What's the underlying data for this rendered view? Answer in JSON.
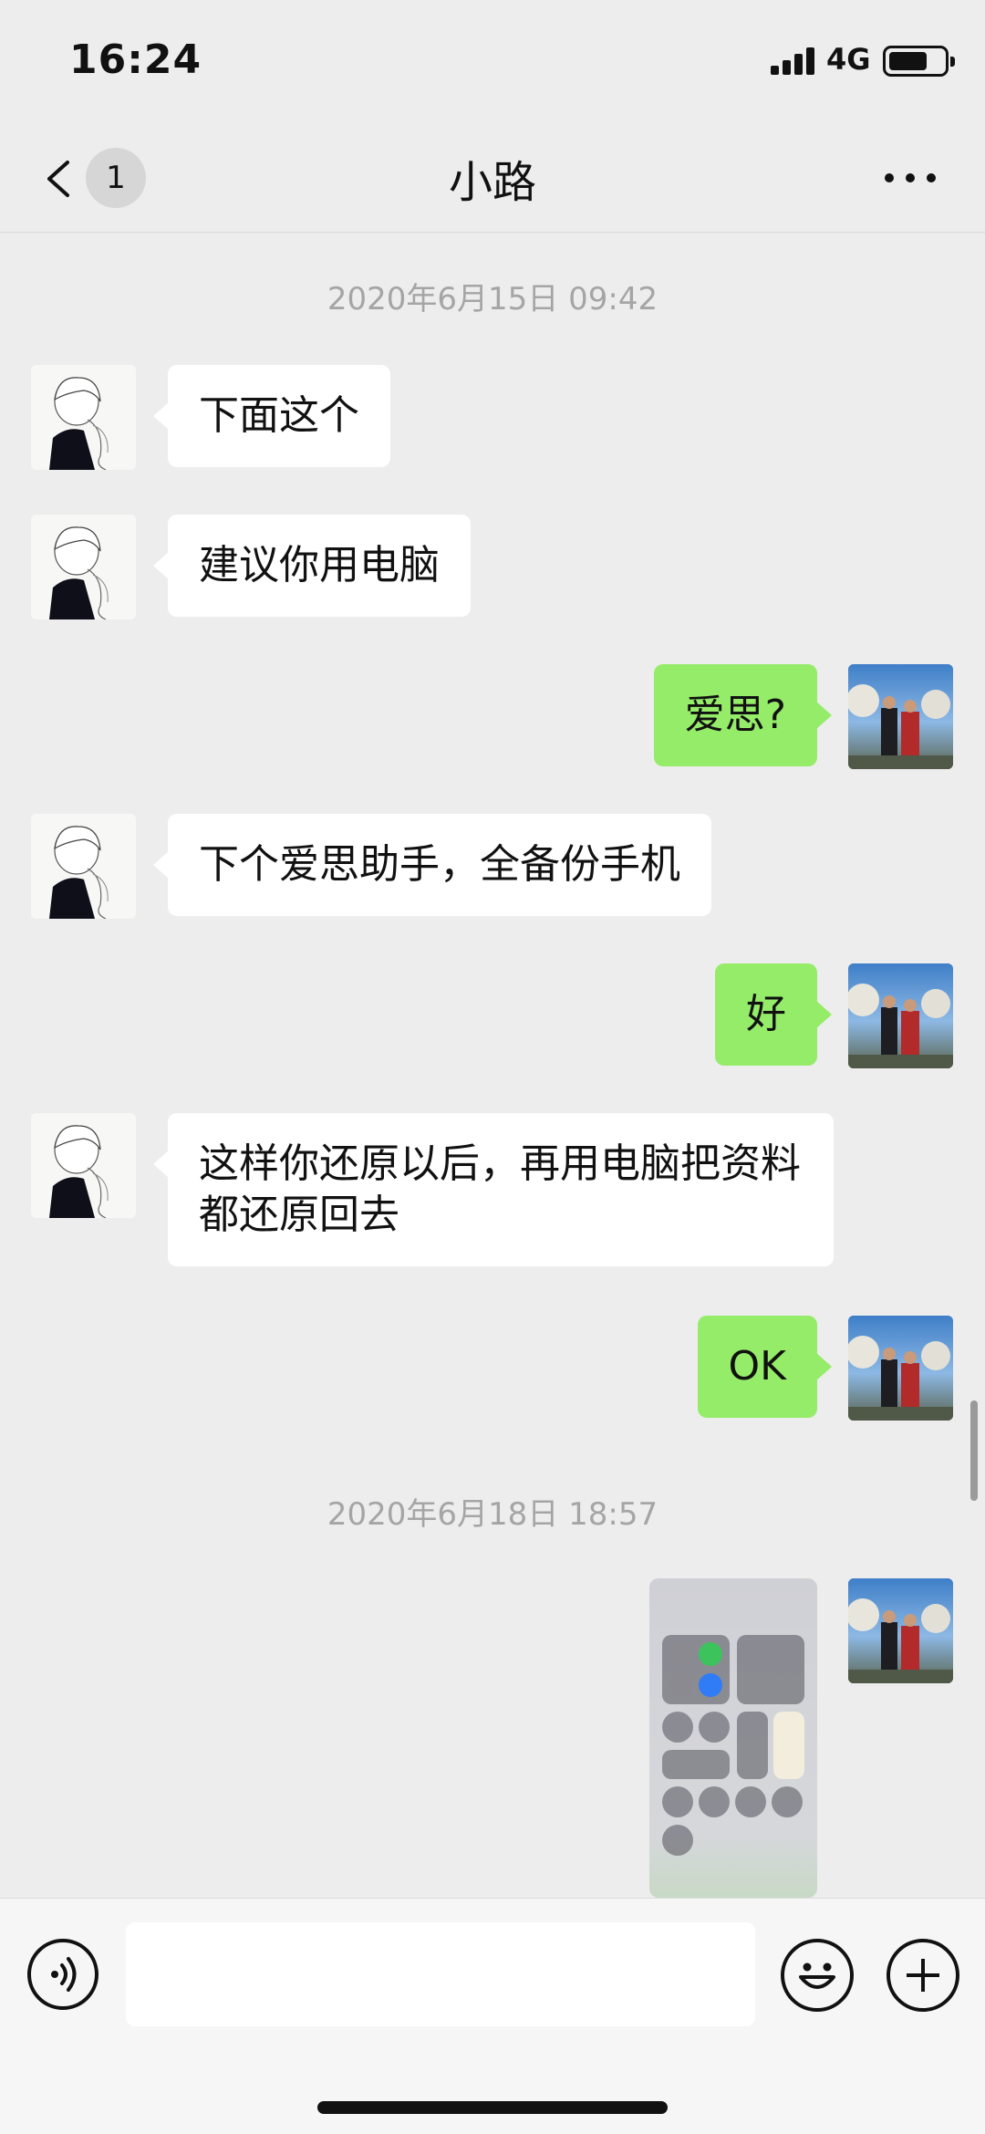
{
  "status_bar": {
    "time": "16:24",
    "network": "4G",
    "battery_level": 0.7
  },
  "header": {
    "unread_count": "1",
    "title": "小路"
  },
  "messages": [
    {
      "type": "timestamp",
      "text": "2020年6月15日 09:42"
    },
    {
      "type": "text",
      "from": "contact",
      "text": "下面这个"
    },
    {
      "type": "text",
      "from": "contact",
      "text": "建议你用电脑"
    },
    {
      "type": "text",
      "from": "me",
      "text": "爱思?"
    },
    {
      "type": "text",
      "from": "contact",
      "text": "下个爱思助手，全备份手机"
    },
    {
      "type": "text",
      "from": "me",
      "text": "好"
    },
    {
      "type": "text",
      "from": "contact",
      "text": "这样你还原以后，再用电脑把资料都还原回去"
    },
    {
      "type": "text",
      "from": "me",
      "text": "OK"
    },
    {
      "type": "timestamp",
      "text": "2020年6月18日 18:57"
    },
    {
      "type": "image",
      "from": "me"
    }
  ],
  "input_bar": {
    "placeholder": ""
  },
  "colors": {
    "background": "#ededed",
    "outgoing_bubble": "#95ec69",
    "incoming_bubble": "#ffffff",
    "timestamp_text": "#a5a5a5"
  },
  "icons": {
    "back": "chevron-left-icon",
    "more": "ellipsis-icon",
    "voice": "voice-icon",
    "emoji": "emoji-icon",
    "plus": "plus-icon"
  }
}
